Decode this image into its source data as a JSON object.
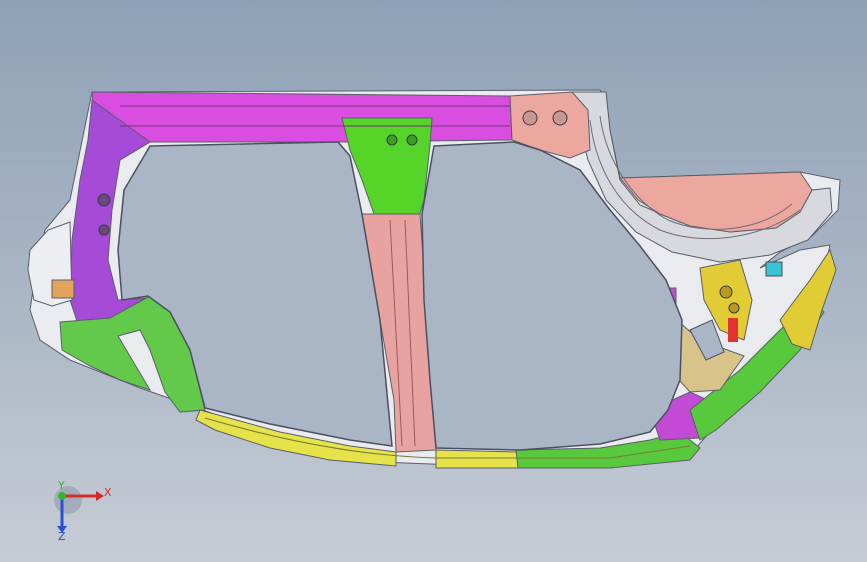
{
  "viewport": {
    "background_top": "#8fa1b8",
    "background_bottom": "#c6ccd5"
  },
  "model": {
    "part_colors": {
      "roof_rail": "#d94ee0",
      "front_pillar": "#a64ad8",
      "b_pillar_upper": "#55d42a",
      "b_pillar_lower": "#e8a3a0",
      "sill_front": "#e6e24a",
      "sill_rear": "#58c83c",
      "rear_arch": "#d7d9df",
      "rear_panel": "#eca79f",
      "rear_bracket": "#e2cc35",
      "front_lower_green": "#62c94a"
    }
  },
  "triad": {
    "x_label": "X",
    "y_label": "Y",
    "z_label": "Z",
    "x_color": "#d42b2b",
    "y_color": "#2fb52f",
    "z_color": "#2a50d1"
  }
}
